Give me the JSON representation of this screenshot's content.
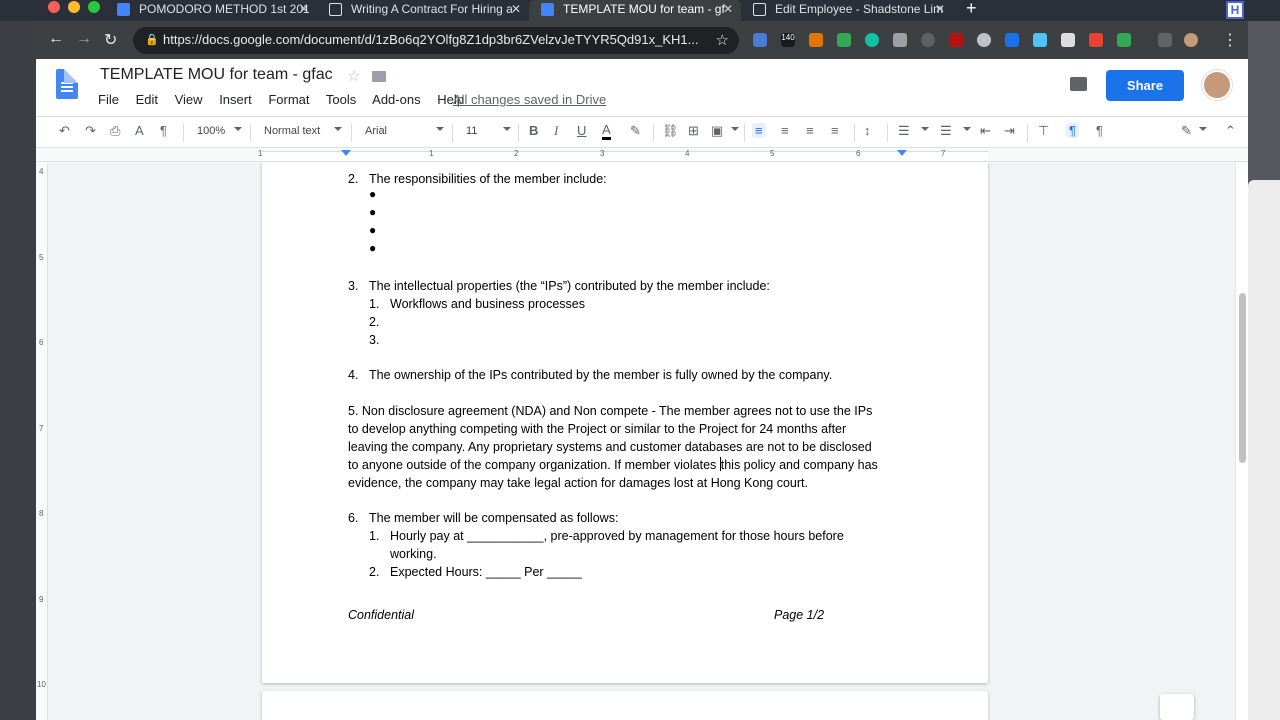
{
  "browser": {
    "tabs": [
      {
        "title": "POMODORO METHOD 1st 201",
        "active": false
      },
      {
        "title": "Writing A Contract For Hiring a",
        "active": false
      },
      {
        "title": "TEMPLATE MOU for team - gf",
        "active": true
      },
      {
        "title": "Edit Employee - Shadstone Lim",
        "active": false
      }
    ],
    "url": "https://docs.google.com/document/d/1zBo6q2YOlfg8Z1dp3br6ZVelzvJeTYYR5Qd91x_KH1...",
    "extension_badge": "140"
  },
  "docs": {
    "title": "TEMPLATE MOU for team - gfac",
    "menu": [
      "File",
      "Edit",
      "View",
      "Insert",
      "Format",
      "Tools",
      "Add-ons",
      "Help"
    ],
    "saved_status": "All changes saved in Drive",
    "share_label": "Share",
    "toolbar": {
      "zoom": "100%",
      "style": "Normal text",
      "font": "Arial",
      "size": "11"
    },
    "ruler_numbers": [
      "1",
      "1",
      "2",
      "3",
      "4",
      "5",
      "6",
      "7"
    ],
    "vruler_numbers": [
      "4",
      "5",
      "6",
      "7",
      "8",
      "9",
      "10"
    ]
  },
  "document": {
    "item2": {
      "num": "2.",
      "text": "The responsibilities of the member include:"
    },
    "item3": {
      "num": "3.",
      "text": "The intellectual properties (the “IPs”) contributed by the member include:",
      "subs": [
        {
          "num": "1.",
          "text": "Workflows and business processes"
        },
        {
          "num": "2.",
          "text": ""
        },
        {
          "num": "3.",
          "text": ""
        }
      ]
    },
    "item4": {
      "num": "4.",
      "text": "The ownership of the IPs contributed by the member is fully owned by the company."
    },
    "item5": {
      "line1": "5.   Non disclosure agreement (NDA) and Non compete - The member agrees not to use the IPs",
      "line2": "to develop anything competing with the Project or similar to the Project for 24 months after",
      "line3": "leaving the company. Any proprietary systems and customer databases are not to be disclosed",
      "line4a": "to anyone outside of the company organization. If member violates ",
      "line4b": "this policy and company has",
      "line5": "evidence, the company may take legal action for damages lost at Hong Kong court."
    },
    "item6": {
      "num": "6.",
      "text": "The member will be compensated as follows:",
      "subs": [
        {
          "num": "1.",
          "text": "Hourly pay at ___________, pre-approved by management for those hours before",
          "cont": "working."
        },
        {
          "num": "2.",
          "text": "Expected Hours: _____ Per _____"
        }
      ]
    },
    "footer_left": "Confidential",
    "footer_right": "Page 1/2"
  }
}
